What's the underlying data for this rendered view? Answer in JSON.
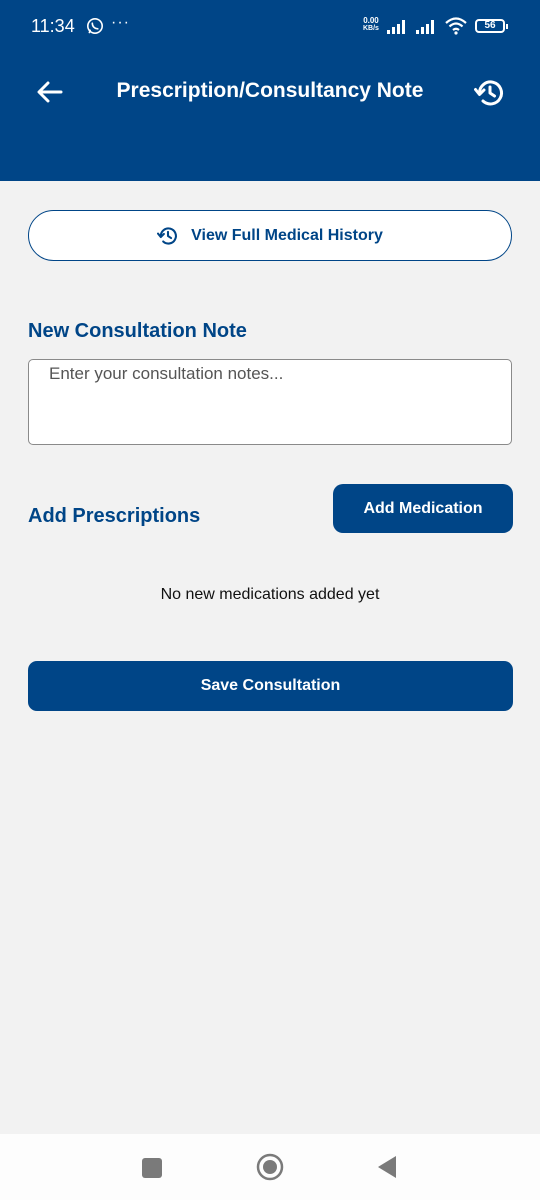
{
  "status_bar": {
    "time": "11:34",
    "dots": "···",
    "net_speed_value": "0.00",
    "net_speed_unit": "KB/s",
    "battery": "56",
    "icons": [
      "whatsapp-icon",
      "signal-icon",
      "signal-icon",
      "wifi-icon",
      "battery-icon"
    ]
  },
  "header": {
    "title": "Prescription/Consultancy Note",
    "back_icon": "arrow-left-icon",
    "history_icon": "history-icon",
    "background_color": "#004587"
  },
  "main": {
    "view_history_label": "View Full Medical History",
    "consultation_title": "New Consultation Note",
    "notes_placeholder": "Enter your consultation notes...",
    "notes_value": "",
    "prescriptions_title": "Add Prescriptions",
    "add_medication_label": "Add Medication",
    "empty_medications_text": "No new medications added yet",
    "save_label": "Save Consultation",
    "accent_color": "#004587"
  },
  "nav_bar": {
    "icons": [
      "recents-square-icon",
      "home-circle-icon",
      "back-triangle-icon"
    ]
  }
}
